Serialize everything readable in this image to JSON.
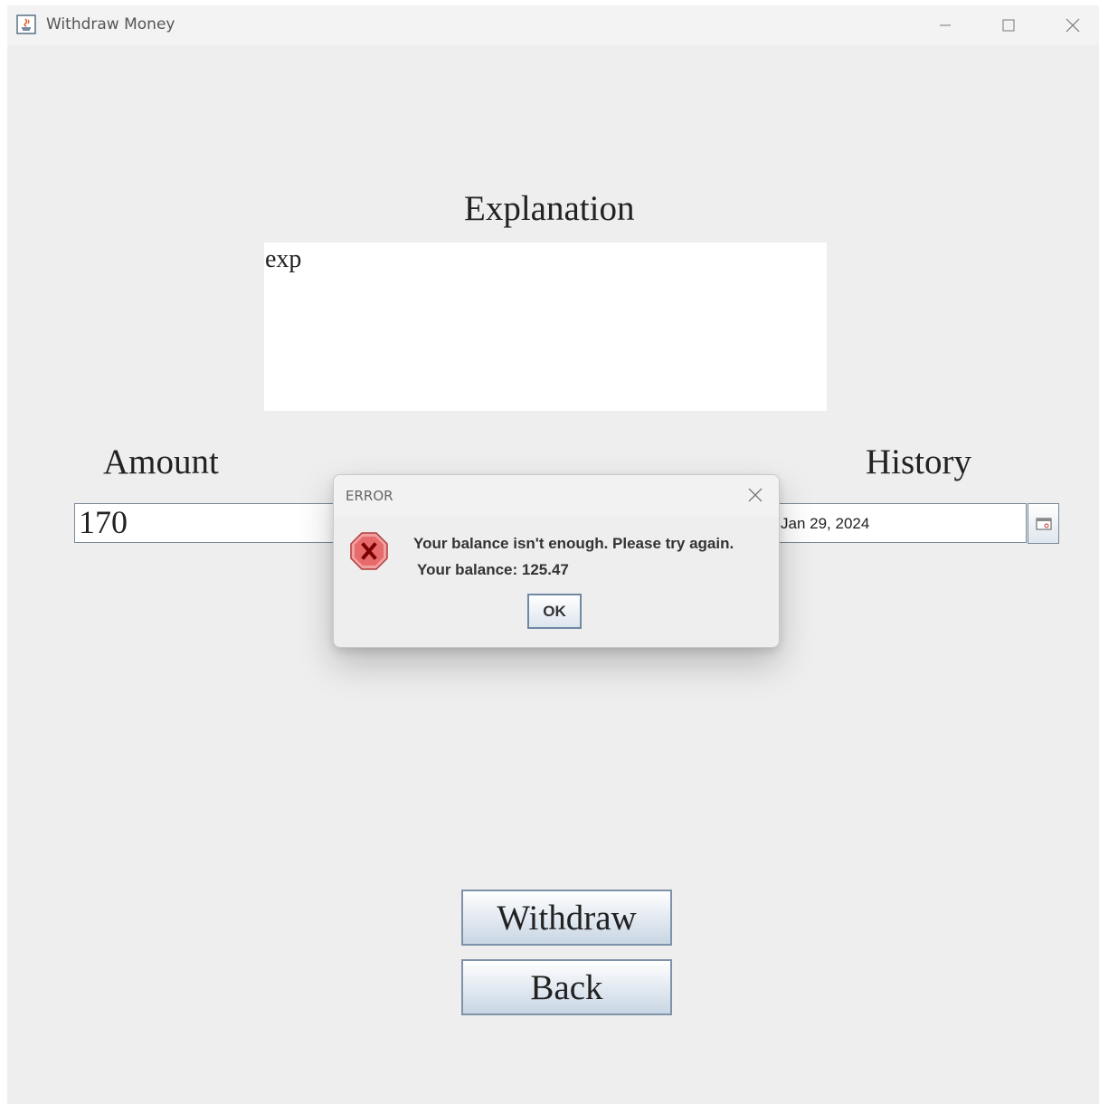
{
  "window": {
    "title": "Withdraw Money",
    "controls": [
      "minimize",
      "maximize",
      "close"
    ]
  },
  "form": {
    "explanation_label": "Explanation",
    "explanation_value": "exp",
    "amount_label": "Amount",
    "amount_value": "170",
    "history_label": "History",
    "history_date": "Jan 29, 2024"
  },
  "buttons": {
    "withdraw_label": "Withdraw",
    "back_label": "Back"
  },
  "dialog": {
    "title": "ERROR",
    "message_line1": "Your balance isn't enough. Please try again.",
    "message_line2": "Your balance: 125.47",
    "ok_label": "OK",
    "icon": "error-icon"
  },
  "colors": {
    "window_bg": "#eeeeee",
    "error_red": "#e05a5a",
    "button_border": "#7f93a8"
  }
}
